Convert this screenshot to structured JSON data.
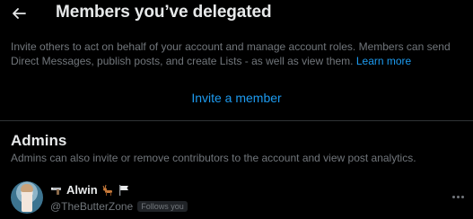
{
  "header": {
    "title": "Members you’ve delegated",
    "back_icon": "arrow-left-icon"
  },
  "intro": {
    "description": "Invite others to act on behalf of your account and manage account roles. Members can send Direct Messages, publish posts, and create Lists - as well as view them.",
    "learn_more": "Learn more",
    "invite_label": "Invite a member"
  },
  "admins": {
    "title": "Admins",
    "description": "Admins can also invite or remove contributors to the account and view post analytics.",
    "members": [
      {
        "name": "Alwin",
        "handle": "@TheButterZone",
        "badge": "Follows you",
        "name_emojis": [
          "pistol-emoji-icon",
          "deer-emoji-icon",
          "black-flag-emoji-icon"
        ]
      }
    ]
  },
  "colors": {
    "background": "#000000",
    "text_primary": "#e7e9ea",
    "text_secondary": "#71767b",
    "accent": "#1d9bf0",
    "divider": "#2f3336"
  }
}
